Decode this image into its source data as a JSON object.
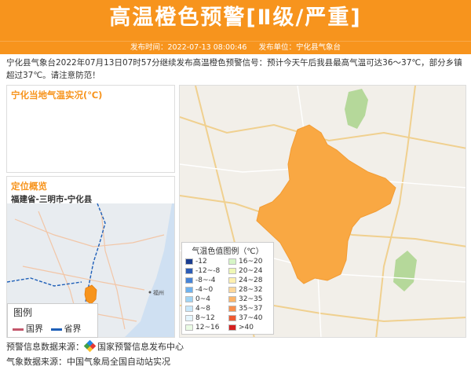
{
  "header": {
    "title": "高温橙色预警[Ⅱ级/严重]"
  },
  "meta": {
    "publish_time": "发布时间：2022-07-13 08:00:46",
    "publisher": "发布单位：宁化县气象台"
  },
  "description": "宁化县气象台2022年07月13日07时57分继续发布高温橙色预警信号：预计今天午后我县最高气温可达36～37℃，部分乡镇超过37℃。请注意防范！",
  "temp_panel": {
    "title": "宁化当地气温实况(℃)"
  },
  "location_panel": {
    "title": "定位概览",
    "path": "福建省-三明市-宁化县"
  },
  "mini_map": {
    "city_label": "福州"
  },
  "mini_legend": {
    "title": "图例",
    "items": [
      {
        "label": "国界",
        "color": "#c4566b"
      },
      {
        "label": "省界",
        "color": "#1e5fb8"
      }
    ]
  },
  "legend": {
    "title": "气温色值图例（℃）",
    "items": [
      {
        "label": "-12",
        "color": "#1a3d8f"
      },
      {
        "label": "16~20",
        "color": "#d6f5c7"
      },
      {
        "label": "-12~-8",
        "color": "#2c5cb5"
      },
      {
        "label": "20~24",
        "color": "#eef7b5"
      },
      {
        "label": "-8~-4",
        "color": "#4683d6"
      },
      {
        "label": "24~28",
        "color": "#fdf0b0"
      },
      {
        "label": "-4~0",
        "color": "#6fb2ee"
      },
      {
        "label": "28~32",
        "color": "#fdd79a"
      },
      {
        "label": "0~4",
        "color": "#9fd4f5"
      },
      {
        "label": "32~35",
        "color": "#fbb56a"
      },
      {
        "label": "4~8",
        "color": "#c8e8fb"
      },
      {
        "label": "35~37",
        "color": "#f88f4d"
      },
      {
        "label": "8~12",
        "color": "#e5f5fd"
      },
      {
        "label": "37~40",
        "color": "#ee5a32"
      },
      {
        "label": "12~16",
        "color": "#eafbe4"
      },
      {
        "label": ">40",
        "color": "#d41f1f"
      }
    ]
  },
  "footer": {
    "warning_source_label": "预警信息数据来源：",
    "warning_source": "国家预警信息发布中心",
    "weather_source": "气象数据来源：中国气象局全国自动站实况"
  },
  "colors": {
    "accent": "#f7941d",
    "warning_area": "#f9a843"
  }
}
